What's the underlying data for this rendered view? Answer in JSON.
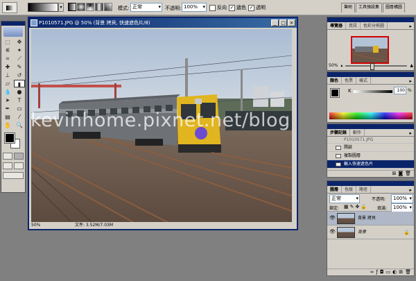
{
  "options_bar": {
    "mode_label": "模式:",
    "mode_value": "正常",
    "opacity_label": "不透明:",
    "opacity_value": "100%",
    "reverse_label": "反向",
    "dither_label": "遞色",
    "transparency_label": "透明",
    "palette_tabs": [
      "筆刷",
      "工具預設集",
      "圖層構圖"
    ]
  },
  "document": {
    "title": "P1010571.JPG @ 50% (背景 拷貝, 快速遮色片/8)",
    "zoom": "50%",
    "file_info": "文件: 3.52M/7.03M",
    "watermark": "kevinhome.pixnet.net/blog"
  },
  "navigator": {
    "tabs": [
      "導覽器",
      "資訊",
      "色彩分佈圖"
    ],
    "zoom": "50%"
  },
  "color_panel": {
    "tabs": [
      "顏色",
      "色票",
      "樣式"
    ],
    "channel": "K",
    "value": "100",
    "unit": "%"
  },
  "history": {
    "tabs": [
      "步驟記錄",
      "動作"
    ],
    "snapshot": "P1010571.JPG",
    "items": [
      "開啟",
      "複製圖層",
      "輸入快速遮色片"
    ]
  },
  "layers": {
    "tabs": [
      "圖層",
      "色版",
      "路徑"
    ],
    "blend_mode": "正常",
    "opacity_label": "不透明:",
    "opacity_value": "100%",
    "lock_label": "鎖定:",
    "fill_label": "填滿:",
    "fill_value": "100%",
    "items": [
      {
        "name": "背景 拷貝"
      },
      {
        "name": "背景"
      }
    ]
  }
}
